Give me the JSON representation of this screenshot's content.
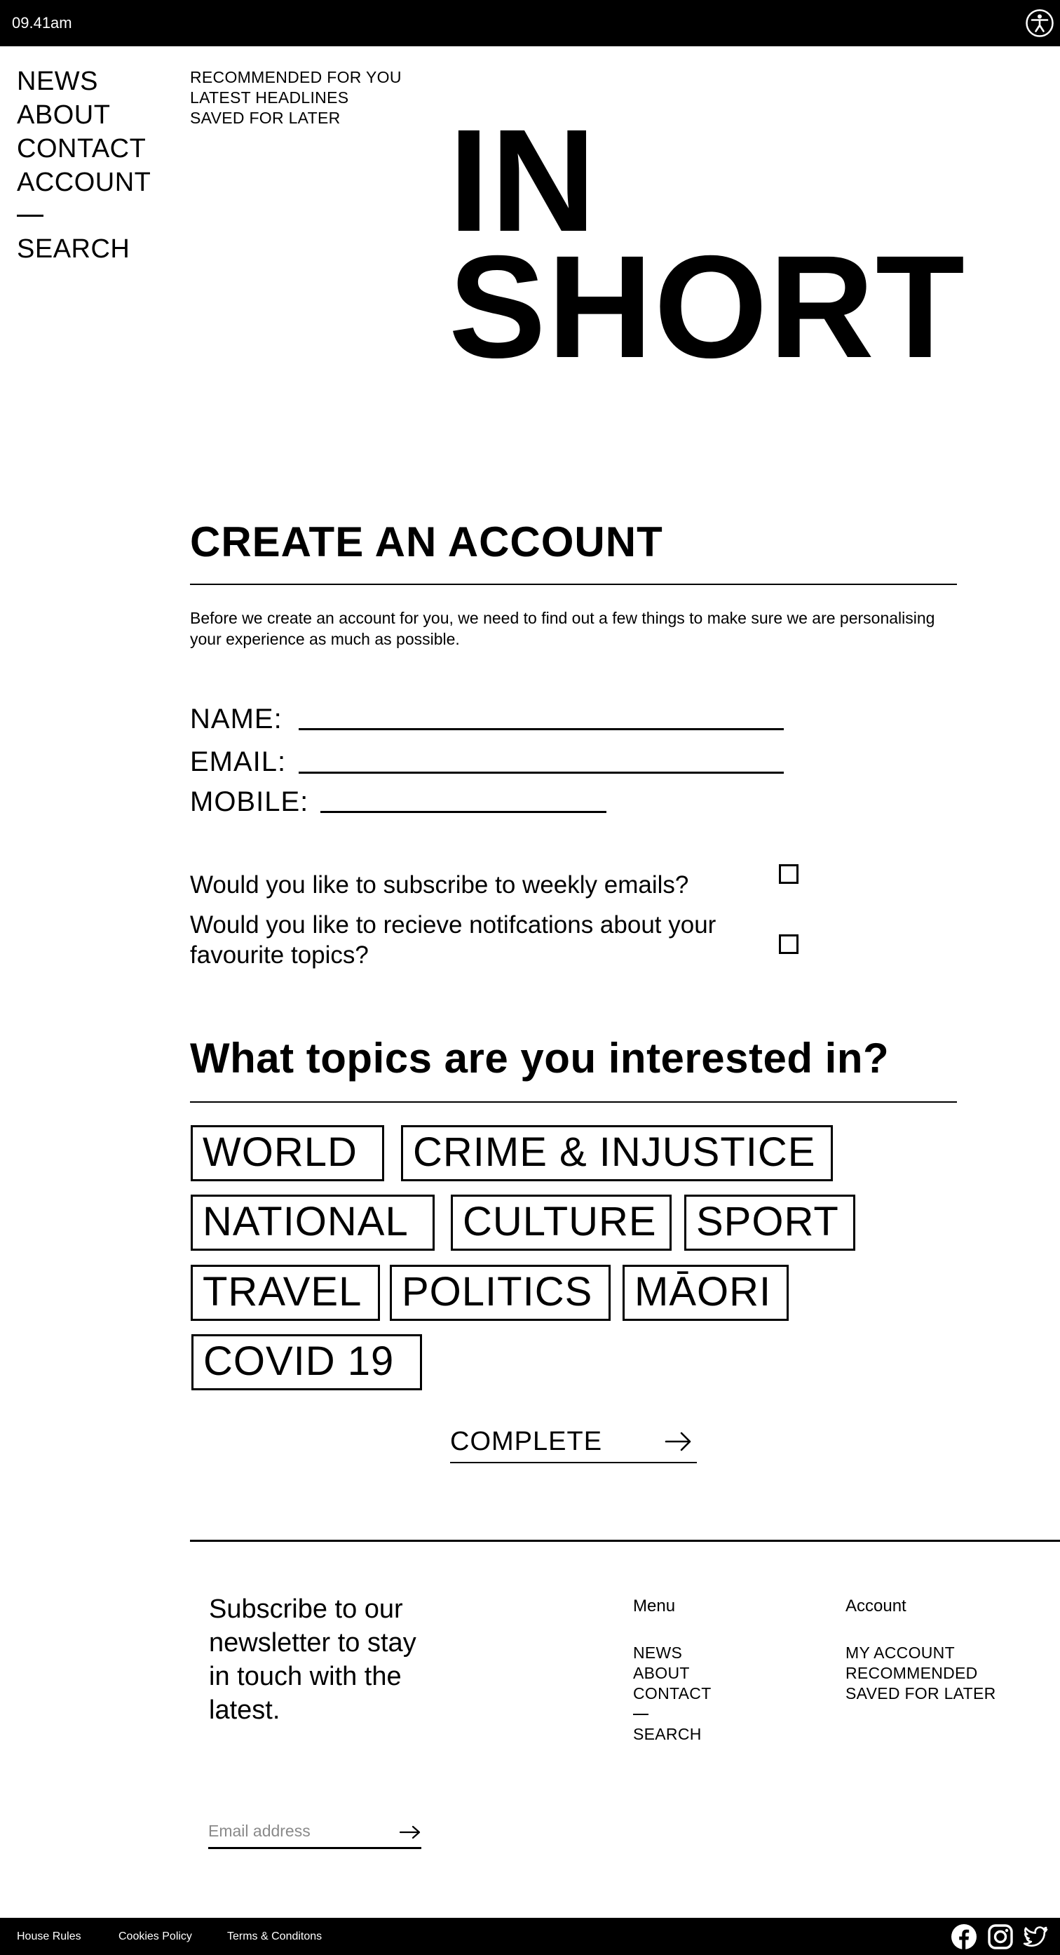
{
  "status_bar": {
    "time": "09.41am",
    "accessibility_icon": "accessibility-icon"
  },
  "main_nav": {
    "items": [
      "NEWS",
      "ABOUT",
      "CONTACT",
      "ACCOUNT"
    ],
    "search": "SEARCH"
  },
  "sub_nav": {
    "items": [
      "RECOMMENDED FOR YOU",
      "LATEST HEADLINES",
      "SAVED FOR LATER"
    ]
  },
  "brand": {
    "line1": "IN",
    "line2": "SHORT"
  },
  "create_account": {
    "title": "CREATE AN ACCOUNT",
    "intro": "Before we create an account for you, we need to find out a few things to make sure we are personalising your experience as much as possible.",
    "fields": {
      "name_label": "NAME:",
      "email_label": "EMAIL:",
      "mobile_label": "MOBILE:"
    },
    "questions": {
      "weekly_emails": "Would you like to subscribe to weekly emails?",
      "notifications": "Would you like to recieve notifcations about your favourite topics?"
    }
  },
  "topics": {
    "title": "What topics are you interested in?",
    "tags": [
      "WORLD",
      "CRIME & INJUSTICE",
      "NATIONAL",
      "CULTURE",
      "SPORT",
      "TRAVEL",
      "POLITICS",
      "MĀORI",
      "COVID 19"
    ]
  },
  "complete_button": {
    "label": "COMPLETE",
    "icon": "arrow-right-icon"
  },
  "footer": {
    "newsletter_text": "Subscribe to our newsletter to stay in touch with the latest.",
    "email_placeholder": "Email address",
    "menu": {
      "title": "Menu",
      "items": [
        "NEWS",
        "ABOUT",
        "CONTACT"
      ],
      "search": "SEARCH"
    },
    "account": {
      "title": "Account",
      "items": [
        "MY ACCOUNT",
        "RECOMMENDED",
        "SAVED FOR LATER"
      ]
    }
  },
  "bottom_bar": {
    "links": [
      "House Rules",
      "Cookies Policy",
      "Terms & Conditons"
    ],
    "social_icons": [
      "facebook-icon",
      "instagram-icon",
      "twitter-icon"
    ]
  },
  "colors": {
    "ink": "#000000",
    "paper": "#ffffff",
    "placeholder": "#8a8a8a"
  }
}
